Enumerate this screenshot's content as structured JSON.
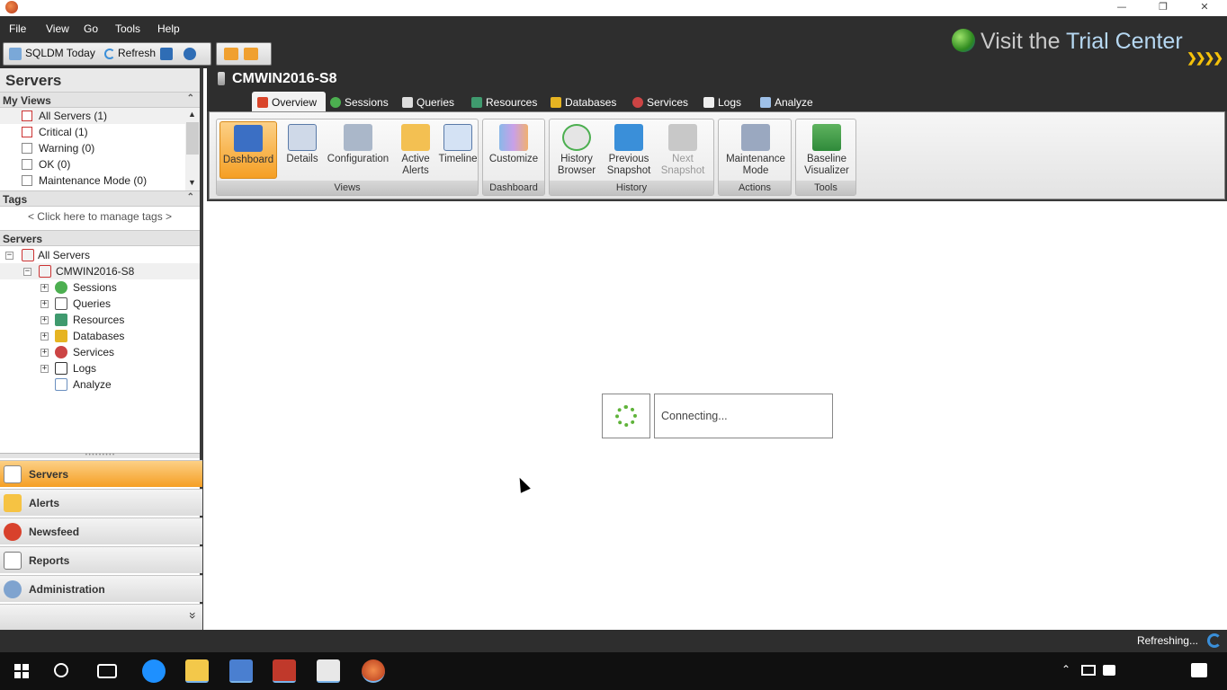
{
  "window": {
    "minimize": "—",
    "maximize": "❐",
    "close": "✕"
  },
  "menu": [
    "File",
    "View",
    "Go",
    "Tools",
    "Help"
  ],
  "toolbar": {
    "today_label": "SQLDM Today",
    "refresh_label": "Refresh"
  },
  "trial": {
    "text_a": "Visit the ",
    "text_b": "Trial Center",
    "arrows": "❯❯❯❯"
  },
  "left": {
    "title": "Servers",
    "my_views_header": "My Views",
    "views": [
      "All Servers (1)",
      "Critical (1)",
      "Warning (0)",
      "OK (0)",
      "Maintenance Mode (0)"
    ],
    "tags_header": "Tags",
    "manage_tags": "< Click here to manage tags >",
    "servers_header": "Servers",
    "tree": {
      "root": "All Servers",
      "server": "CMWIN2016-S8",
      "children": [
        "Sessions",
        "Queries",
        "Resources",
        "Databases",
        "Services",
        "Logs",
        "Analyze"
      ]
    },
    "nav": [
      "Servers",
      "Alerts",
      "Newsfeed",
      "Reports",
      "Administration"
    ],
    "more": "»"
  },
  "server": {
    "name": "CMWIN2016-S8"
  },
  "tabs": [
    "Overview",
    "Sessions",
    "Queries",
    "Resources",
    "Databases",
    "Services",
    "Logs",
    "Analyze"
  ],
  "ribbon": {
    "groups": [
      "Views",
      "Dashboard",
      "History",
      "Actions",
      "Tools"
    ],
    "buttons": {
      "dashboard": "Dashboard",
      "details": "Details",
      "configuration": "Configuration",
      "active_alerts_1": "Active",
      "active_alerts_2": "Alerts",
      "timeline": "Timeline",
      "customize": "Customize",
      "history_1": "History",
      "history_2": "Browser",
      "prev_1": "Previous",
      "prev_2": "Snapshot",
      "next_1": "Next",
      "next_2": "Snapshot",
      "maint_1": "Maintenance",
      "maint_2": "Mode",
      "baseline_1": "Baseline",
      "baseline_2": "Visualizer"
    }
  },
  "content": {
    "connecting": "Connecting..."
  },
  "status": {
    "text": "Refreshing..."
  },
  "colors": {
    "accent": "#f5a623",
    "dark": "#2e2e2e",
    "ribbon_bg": "#e9e9e9"
  }
}
